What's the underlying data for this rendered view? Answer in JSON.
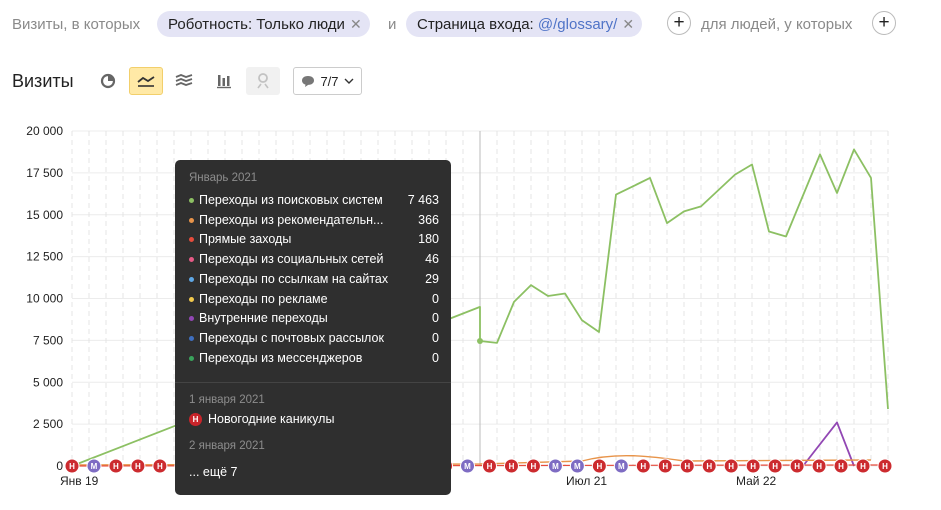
{
  "filters": {
    "prefix": "Визиты, в которых",
    "chip1": {
      "label": "Роботность: Только люди"
    },
    "and_label": "и",
    "chip2": {
      "label": "Страница входа:",
      "value": "@/glossary/"
    },
    "suffix": "для людей, у которых"
  },
  "toolbar": {
    "title": "Визиты",
    "icons": [
      "pie-icon",
      "line-chart-icon",
      "stacked-area-icon",
      "bar-chart-icon",
      "map-icon"
    ],
    "active": "line-chart-icon",
    "series_selector_label": "7/7"
  },
  "chart_data": {
    "type": "line",
    "yticks": [
      "20 000",
      "17 500",
      "15 000",
      "12 500",
      "10 000",
      "7 500",
      "5 000",
      "2 500",
      "0"
    ],
    "ylim": [
      0,
      20000
    ],
    "xticks": [
      "Янв 19",
      "Июл 21",
      "Май 22"
    ],
    "series": [
      {
        "name": "Переходы из поисковых систем",
        "color": "#8cc063",
        "points": [
          [
            "2019-01",
            0
          ],
          [
            "2021-01",
            9500
          ],
          [
            "2021-01",
            7463
          ],
          [
            "2021-02",
            7350
          ],
          [
            "2021-03",
            9800
          ],
          [
            "2021-04",
            10800
          ],
          [
            "2021-05",
            10150
          ],
          [
            "2021-06",
            10300
          ],
          [
            "2021-07",
            8700
          ],
          [
            "2021-08",
            8000
          ],
          [
            "2021-09",
            16200
          ],
          [
            "2021-10",
            16700
          ],
          [
            "2021-11",
            17200
          ],
          [
            "2021-12",
            14500
          ],
          [
            "2022-01",
            15200
          ],
          [
            "2022-02",
            15500
          ],
          [
            "2022-04",
            17400
          ],
          [
            "2022-05",
            18000
          ],
          [
            "2022-06",
            14000
          ],
          [
            "2022-07",
            13700
          ],
          [
            "2022-09",
            18600
          ],
          [
            "2022-10",
            16300
          ],
          [
            "2022-11",
            18900
          ],
          [
            "2022-12",
            17200
          ],
          [
            "2023-01",
            3400
          ]
        ]
      },
      {
        "name": "Внутренние переходы",
        "color": "#9247b4",
        "points": [
          [
            "2022-08",
            0
          ],
          [
            "2022-10",
            2600
          ],
          [
            "2022-11",
            0
          ]
        ]
      }
    ],
    "markers": "Н М Н Н Н Н Н Н Н Н Н Н М Н Н Н Н Н М Н Н Н М М Н М Н Н Н Н Н Н Н Н Н Н Н Н",
    "tooltip": {
      "header": "Январь 2021",
      "rows": [
        {
          "name": "Переходы из поисковых систем",
          "value": "7 463",
          "color": "#8cc063"
        },
        {
          "name": "Переходы из рекомендательн...",
          "value": "366",
          "color": "#e8944a"
        },
        {
          "name": "Прямые заходы",
          "value": "180",
          "color": "#e74c3c"
        },
        {
          "name": "Переходы из социальных сетей",
          "value": "46",
          "color": "#e75a86"
        },
        {
          "name": "Переходы по ссылкам на сайтах",
          "value": "29",
          "color": "#5fa8e6"
        },
        {
          "name": "Переходы по рекламе",
          "value": "0",
          "color": "#f2c94c"
        },
        {
          "name": "Внутренние переходы",
          "value": "0",
          "color": "#9247b4"
        },
        {
          "name": "Переходы с почтовых рассылок",
          "value": "0",
          "color": "#3f6fbf"
        },
        {
          "name": "Переходы из мессенджеров",
          "value": "0",
          "color": "#3aa35c"
        }
      ],
      "date1": "1 января 2021",
      "holiday_badge": "Н",
      "holiday_label": "Новогодние каникулы",
      "date2": "2 января 2021",
      "more": "... ещё 7"
    }
  }
}
